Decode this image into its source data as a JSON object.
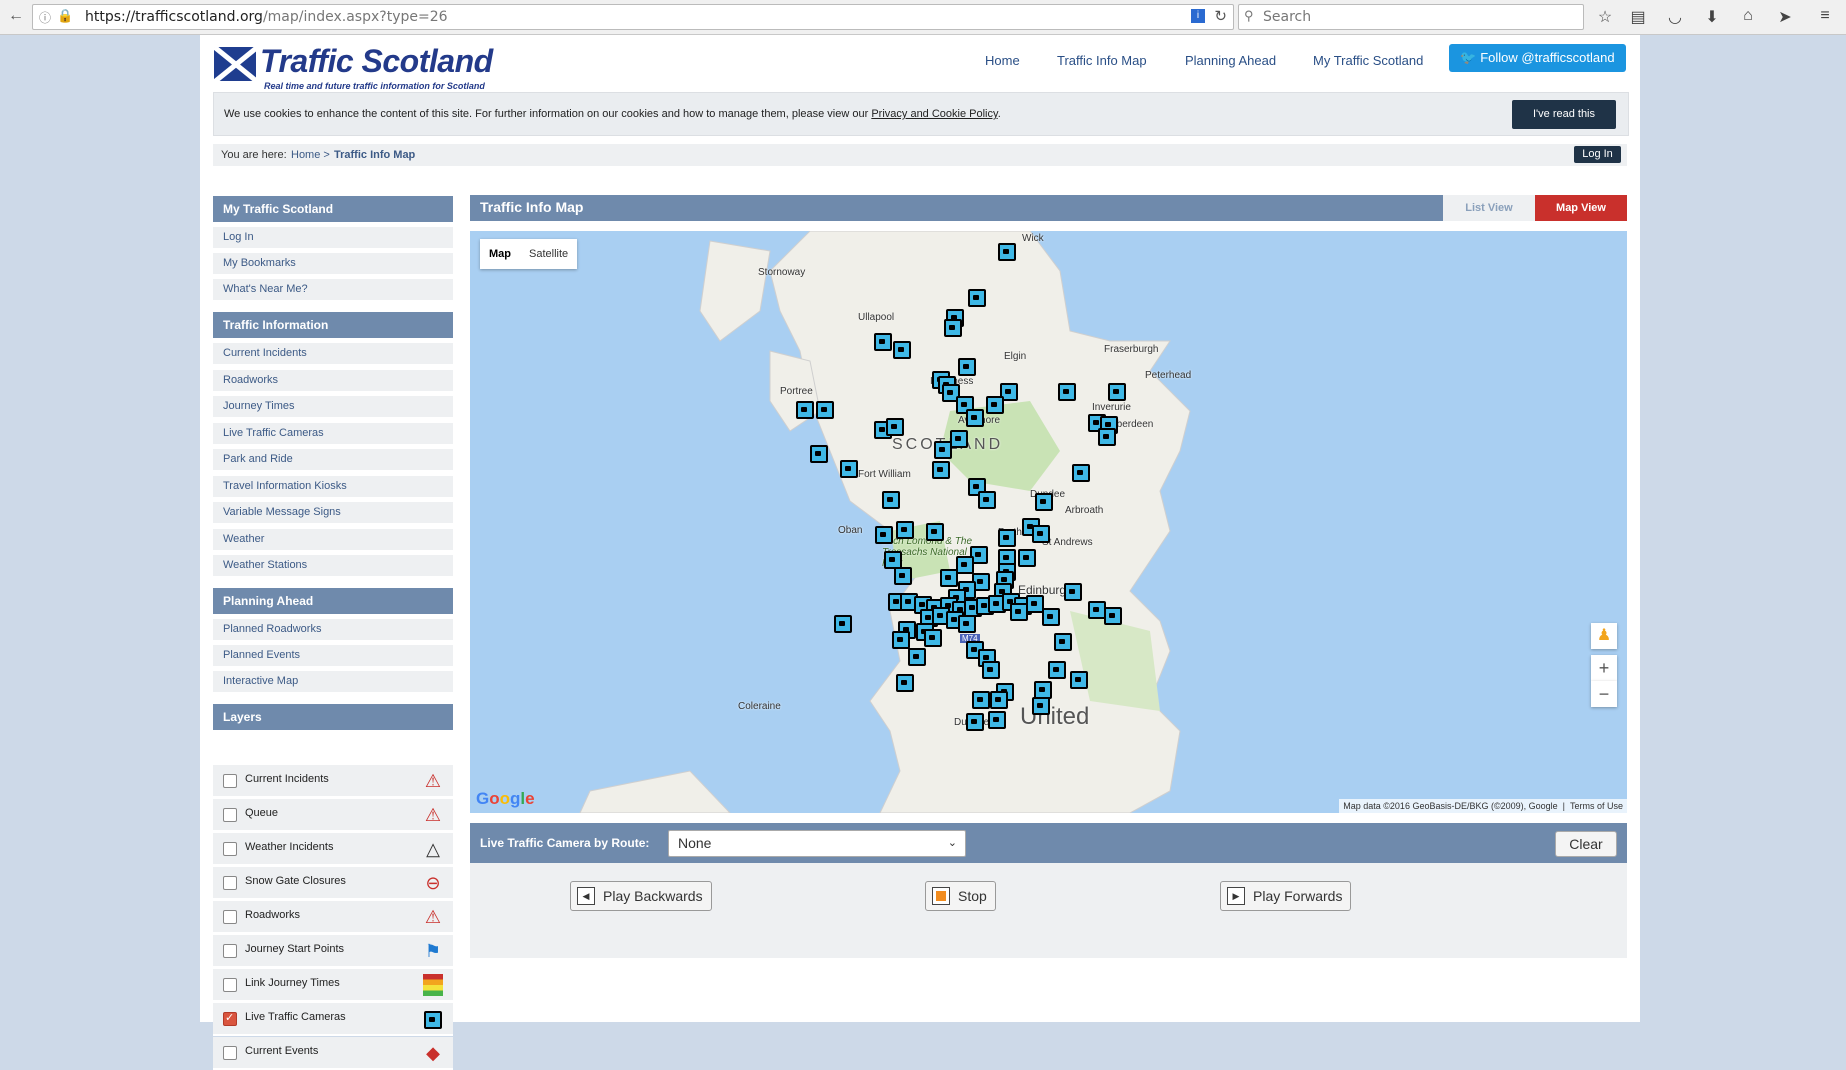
{
  "browser": {
    "url_host": "https://trafficscotland.org",
    "url_path": "/map/index.aspx?type=26",
    "search_placeholder": "Search"
  },
  "site": {
    "logo_name": "Traffic Scotland",
    "logo_tagline": "Real time and future traffic information for Scotland",
    "nav": [
      "Home",
      "Traffic Info Map",
      "Planning Ahead",
      "My Traffic Scotland"
    ],
    "follow_label": "Follow @trafficscotland"
  },
  "cookie": {
    "text": "We use cookies to enhance the content of this site. For further information on our cookies and how to manage them, please view our ",
    "link": "Privacy and Cookie Policy",
    "after": ".",
    "button": "I've read this"
  },
  "breadcrumb": {
    "prefix": "You are here:",
    "home": "Home >",
    "current": "Traffic Info Map",
    "login": "Log In"
  },
  "sidebar": {
    "my_traffic": {
      "title": "My Traffic Scotland",
      "items": [
        "Log In",
        "My Bookmarks",
        "What's Near Me?"
      ]
    },
    "traffic_info": {
      "title": "Traffic Information",
      "items": [
        "Current Incidents",
        "Roadworks",
        "Journey Times",
        "Live Traffic Cameras",
        "Park and Ride",
        "Travel Information Kiosks",
        "Variable Message Signs",
        "Weather",
        "Weather Stations"
      ]
    },
    "planning": {
      "title": "Planning Ahead",
      "items": [
        "Planned Roadworks",
        "Planned Events",
        "Interactive Map"
      ]
    },
    "layers": {
      "title": "Layers",
      "items": [
        {
          "label": "Current Incidents",
          "checked": false,
          "icon": "warning-triangle-icon"
        },
        {
          "label": "Queue",
          "checked": false,
          "icon": "queue-icon"
        },
        {
          "label": "Weather Incidents",
          "checked": false,
          "icon": "weather-warning-icon"
        },
        {
          "label": "Snow Gate Closures",
          "checked": false,
          "icon": "snow-gate-icon"
        },
        {
          "label": "Roadworks",
          "checked": false,
          "icon": "roadworks-icon"
        },
        {
          "label": "Journey Start Points",
          "checked": false,
          "icon": "flag-icon"
        },
        {
          "label": "Link Journey Times",
          "checked": false,
          "icon": "journey-times-icon"
        },
        {
          "label": "Live Traffic Cameras",
          "checked": true,
          "icon": "camera-icon"
        },
        {
          "label": "Current Events",
          "checked": false,
          "icon": "event-icon"
        }
      ]
    }
  },
  "main": {
    "title": "Traffic Info Map",
    "list_view": "List View",
    "map_view": "Map View",
    "map_type": [
      "Map",
      "Satellite"
    ],
    "place_labels": [
      "Wick",
      "Stornoway",
      "Ullapool",
      "Fraserburgh",
      "Elgin",
      "Peterhead",
      "Portree",
      "Inverness",
      "Inverurie",
      "Aviemore",
      "Aberdeen",
      "SCOTLAND",
      "Fort William",
      "Arbroath",
      "Dundee",
      "Oban",
      "St Andrews",
      "Perth",
      "Loch Lomond & The Trossachs National Park",
      "Edinburgh",
      "Coleraine",
      "United",
      "Dumfries",
      "M74"
    ],
    "attribution": "Map data ©2016 GeoBasis-DE/BKG (©2009), Google",
    "terms": "Terms of Use",
    "google": "Google",
    "route_label": "Live Traffic Camera by Route:",
    "route_value": "None",
    "clear": "Clear",
    "play_back": "Play Backwards",
    "stop": "Stop",
    "play_fwd": "Play Forwards"
  },
  "colors": {
    "header_bar": "#6f8aac",
    "map_view_active": "#c9302c",
    "dark_button": "#1f3347",
    "twitter": "#1b95e0",
    "camera_marker": "#3fb8e6"
  }
}
